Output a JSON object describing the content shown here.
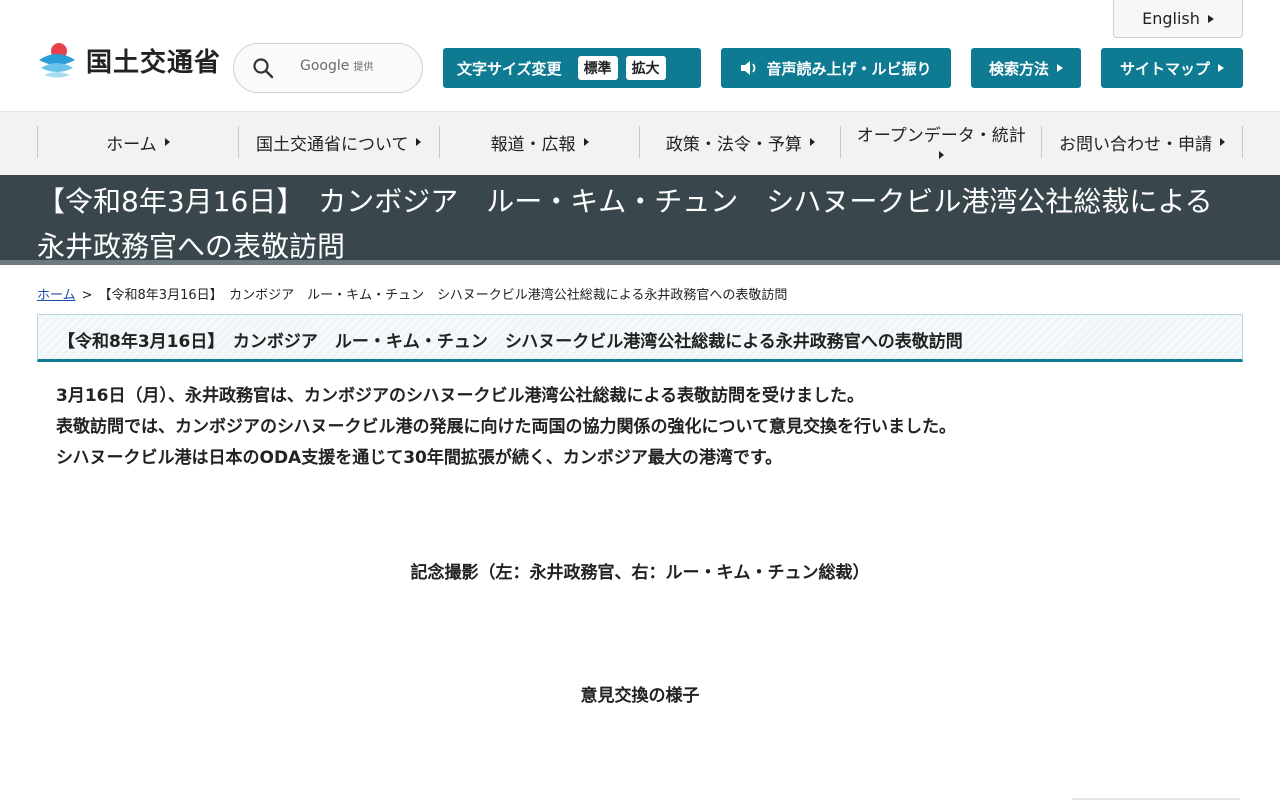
{
  "header": {
    "logo_text": "国土交通省",
    "search": {
      "placeholder": "",
      "google_label": "Google",
      "provided_label": "提供"
    },
    "english_label": "English",
    "font_size": {
      "label": "文字サイズ変更",
      "standard": "標準",
      "large": "拡大"
    },
    "speech_label": "音声読み上げ・ルビ振り",
    "search_method_label": "検索方法",
    "sitemap_label": "サイトマップ"
  },
  "nav": {
    "items": [
      {
        "label": "ホーム"
      },
      {
        "label": "国土交通省について"
      },
      {
        "label": "報道・広報"
      },
      {
        "label": "政策・法令・予算"
      },
      {
        "label": "オープンデータ・統計"
      },
      {
        "label": "お問い合わせ・申請"
      }
    ]
  },
  "page": {
    "title": "【令和8年3月16日】　カンボジア　ルー・キム・チュン　シハヌークビル港湾公社総裁による永井政務官への表敬訪問",
    "breadcrumb": {
      "home": "ホーム",
      "separator": ">",
      "current": "【令和8年3月16日】　カンボジア　ルー・キム・チュン　シハヌークビル港湾公社総裁による永井政務官への表敬訪問"
    },
    "heading": "【令和8年3月16日】　カンボジア　ルー・キム・チュン　シハヌークビル港湾公社総裁による永井政務官への表敬訪問",
    "paragraphs": [
      "3月16日（月）、永井政務官は、カンボジアのシハヌークビル港湾公社総裁による表敬訪問を受けました。",
      "表敬訪問では、カンボジアのシハヌークビル港の発展に向けた両国の協力関係の強化について意見交換を行いました。",
      "シハヌークビル港は日本のODA支援を通じて30年間拡張が続く、カンボジア最大の港湾です。"
    ],
    "captions": [
      "記念撮影（左：永井政務官、右：ルー・キム・チュン総裁）",
      "意見交換の様子"
    ]
  },
  "colors": {
    "accent": "#0e7b93",
    "title_band": "#39474d",
    "nav_bg": "#f2f2f2",
    "link": "#1a4ea8"
  }
}
